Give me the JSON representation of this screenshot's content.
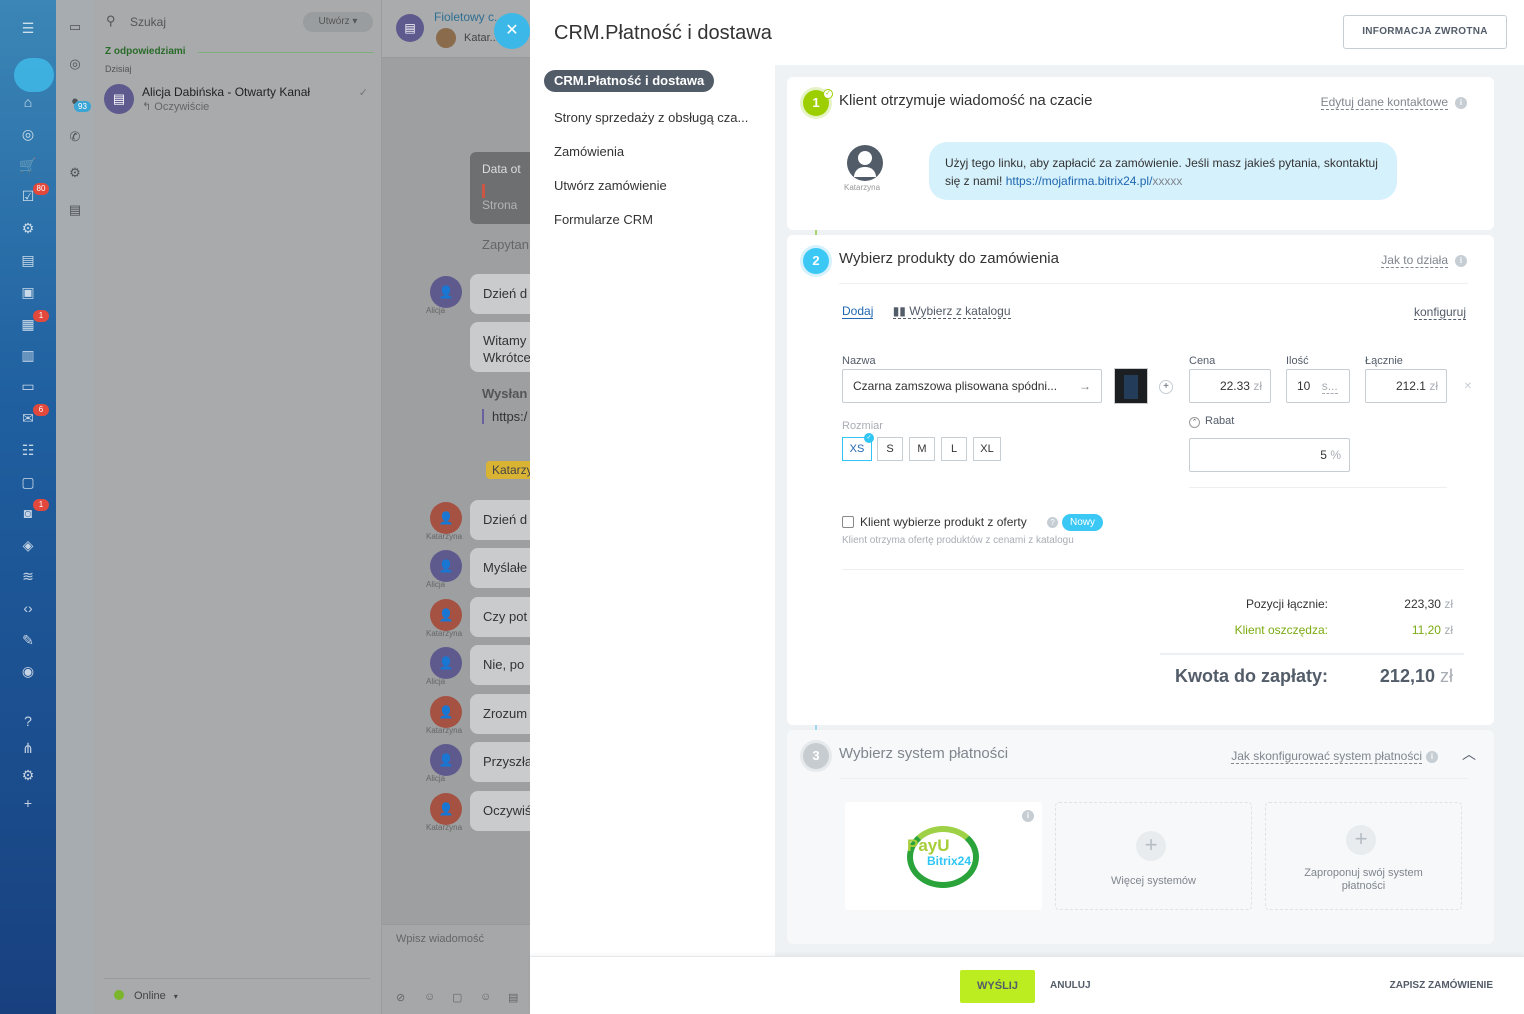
{
  "sidebar": {
    "badges": {
      "tasks": "80",
      "calendar": "1",
      "mail": "6",
      "robot": "1"
    }
  },
  "subnav": {
    "badge": "93"
  },
  "chatlist": {
    "search_placeholder": "Szukaj",
    "create_label": "Utwórz",
    "section": "Z odpowiedziami",
    "today": "Dzisiaj",
    "items": [
      {
        "name": "Alicja Dabińska - Otwarty Kanał",
        "last": "Oczywiście"
      }
    ],
    "status": "Online"
  },
  "chat": {
    "title": "Fioletowy c...",
    "subtitle": "Katar...",
    "system": {
      "title": "Data ot",
      "line": "Strona"
    },
    "messages": [
      {
        "author": "Alicja",
        "text": "Dzień d"
      },
      {
        "author": "",
        "text": "Witamy Wkrótce"
      },
      {
        "author": "Katarzyna",
        "text": "Dzień d"
      },
      {
        "author": "Alicja",
        "text": "Myślałe"
      },
      {
        "author": "Katarzyna",
        "text": "Czy pot"
      },
      {
        "author": "Alicja",
        "text": "Nie, po"
      },
      {
        "author": "Katarzyna",
        "text": "Zrozum"
      },
      {
        "author": "Alicja",
        "text": "Przyszła"
      },
      {
        "author": "Katarzyna",
        "text": "Oczywiś"
      }
    ],
    "plain1": "Zapytan",
    "sent_label": "Wysłan",
    "sent_link": "https:/",
    "kat_tag": "Katarzy",
    "input_placeholder": "Wpisz wiadomość"
  },
  "panel": {
    "title": "CRM.Płatność i dostawa",
    "feedback": "INFORMACJA ZWROTNA",
    "menu": [
      "CRM.Płatność i dostawa",
      "Strony sprzedaży z obsługą cza...",
      "Zamówienia",
      "Utwórz zamówienie",
      "Formularze CRM"
    ],
    "step1": {
      "num": "1",
      "title": "Klient otrzymuje wiadomość na czacie",
      "link": "Edytuj dane kontaktowe",
      "avatar_name": "Katarzyna",
      "message": "Użyj tego linku, aby zapłacić za zamówienie. Jeśli masz jakieś pytania, skontaktuj się z nami!",
      "url": "https://mojafirma.bitrix24.pl/",
      "url_tail": "xxxxx"
    },
    "step2": {
      "num": "2",
      "title": "Wybierz produkty do zamówienia",
      "link": "Jak to działa",
      "add": "Dodaj",
      "catalog": "Wybierz z katalogu",
      "configure": "konfiguruj",
      "labels": {
        "name": "Nazwa",
        "price": "Cena",
        "qty": "Ilość",
        "total": "Łącznie",
        "size": "Rozmiar",
        "discount": "Rabat"
      },
      "product": "Czarna zamszowa plisowana spódni...",
      "price": "22.33",
      "price_unit": "zł",
      "qty": "10",
      "qty_unit": "s...",
      "total": "212.1",
      "total_unit": "zł",
      "sizes": [
        "XS",
        "S",
        "M",
        "L",
        "XL"
      ],
      "discount": "5",
      "discount_unit": "%",
      "offer_label": "Klient wybierze produkt z oferty",
      "offer_badge": "Nowy",
      "offer_sub": "Klient otrzyma ofertę produktów z cenami z katalogu",
      "positions_label": "Pozycji łącznie:",
      "positions_value": "223,30",
      "saves_label": "Klient oszczędza:",
      "saves_value": "11,20",
      "currency": "zł",
      "topay_label": "Kwota do zapłaty:",
      "topay_value": "212,10"
    },
    "step3": {
      "num": "3",
      "title": "Wybierz system płatności",
      "link": "Jak skonfigurować system płatności",
      "payu_text": "PayU",
      "bitrix_text": "Bitrix24",
      "more": "Więcej systemów",
      "propose": "Zaproponuj swój system płatności"
    },
    "footer": {
      "send": "WYŚLIJ",
      "cancel": "ANULUJ",
      "save": "ZAPISZ ZAMÓWIENIE"
    }
  },
  "colors": {
    "accent": "#3bc8f5",
    "send": "#bbed21",
    "step1": "#9dcf00"
  }
}
